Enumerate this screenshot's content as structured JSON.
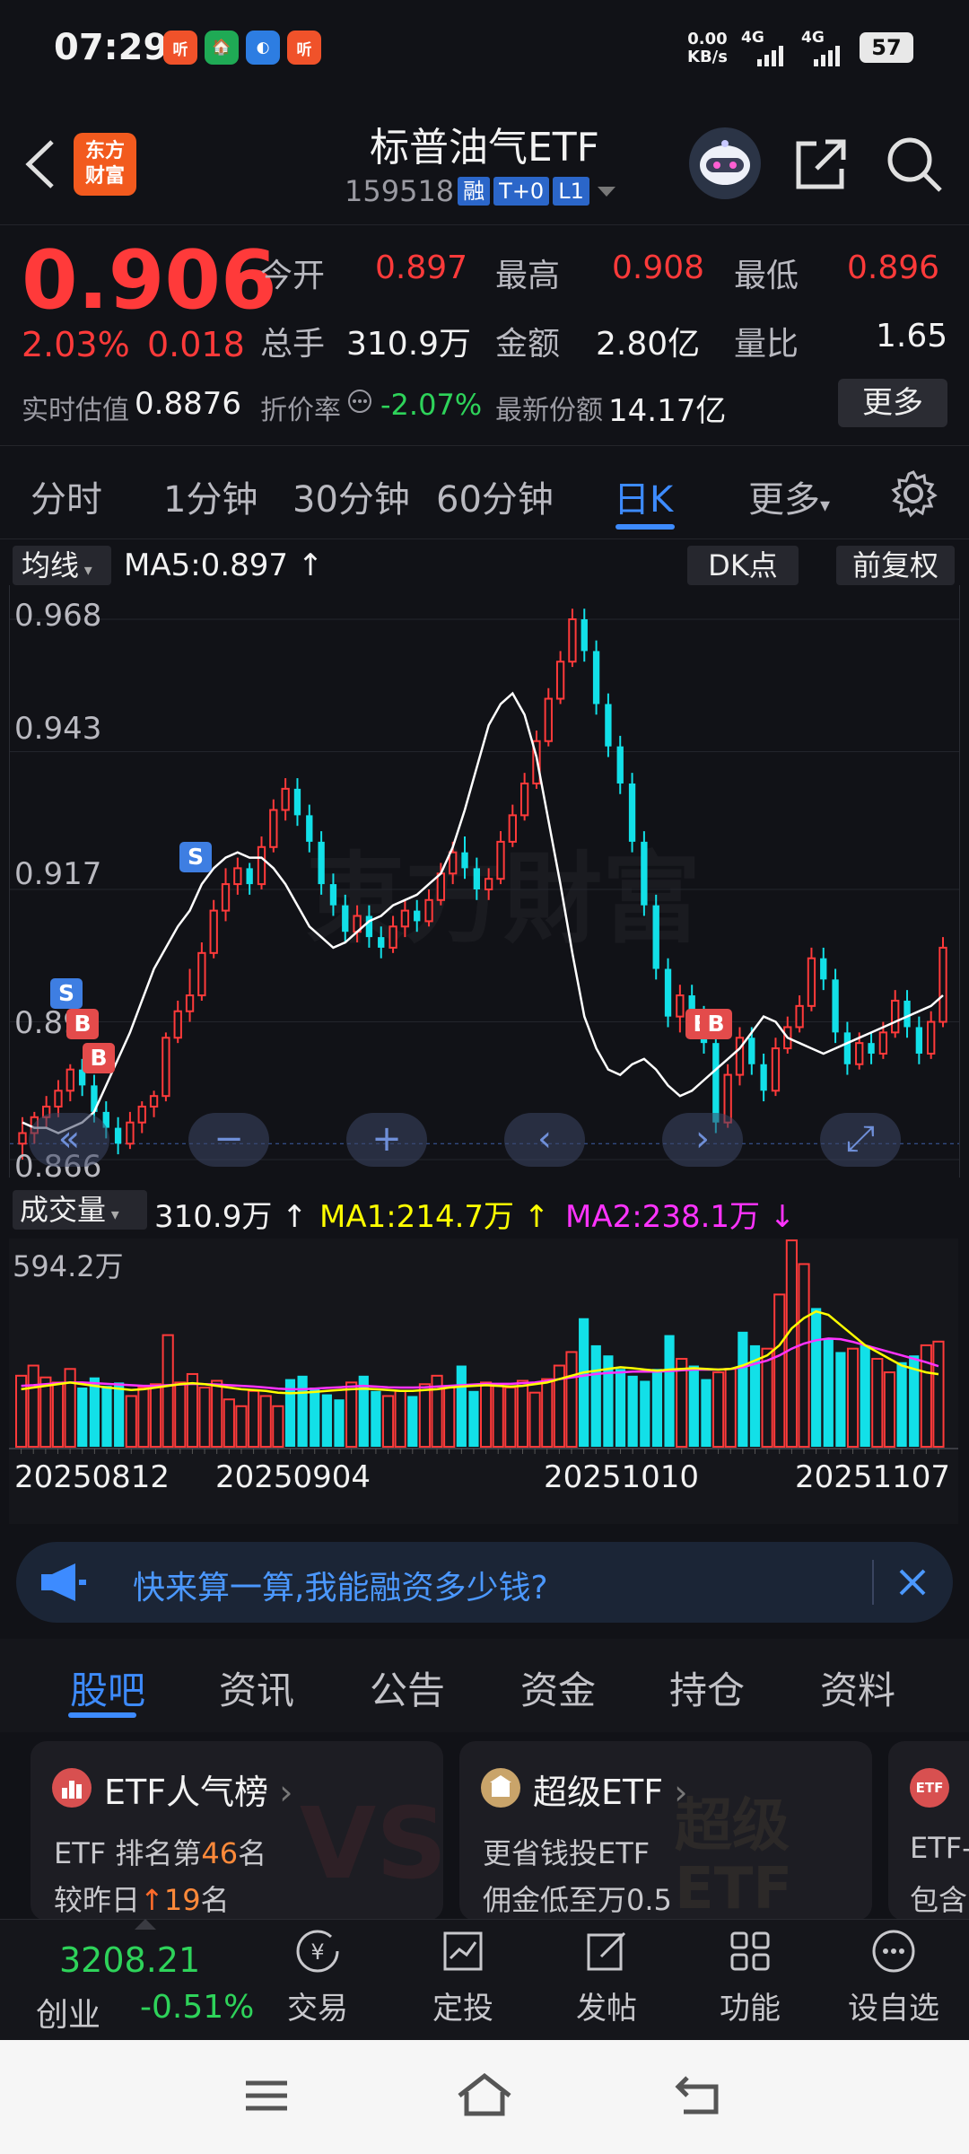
{
  "status_bar": {
    "time": "07:29",
    "apps": [
      "听",
      "🏠",
      "◐",
      "听"
    ],
    "net_speed": "0.00",
    "net_unit": "KB/s",
    "sig1": "4G",
    "sig2": "4G",
    "battery": "57"
  },
  "header": {
    "logo_line1": "东方",
    "logo_line2": "财富",
    "title": "标普油气ETF",
    "code": "159518",
    "tags": [
      "融",
      "T+0",
      "L1"
    ]
  },
  "quote": {
    "price": "0.906",
    "change_pct": "2.03%",
    "change_abs": "0.018",
    "open_label": "今开",
    "open_value": "0.897",
    "high_label": "最高",
    "high_value": "0.908",
    "low_label": "最低",
    "low_value": "0.896",
    "volume_label": "总手",
    "volume_value": "310.9万",
    "amount_label": "金额",
    "amount_value": "2.80亿",
    "ratio_label": "量比",
    "ratio_value": "1.65",
    "iopv_label": "实时估值",
    "iopv_value": "0.8876",
    "discount_label": "折价率",
    "discount_value": "-2.07%",
    "shares_label": "最新份额",
    "shares_value": "14.17亿",
    "more_button": "更多"
  },
  "period_tabs": [
    "分时",
    "1分钟",
    "30分钟",
    "60分钟",
    "日K",
    "更多"
  ],
  "active_period": "日K",
  "chart_toolbar": {
    "indicator": "均线",
    "ma5": "MA5:0.897",
    "dk_button": "DK点",
    "adjust_button": "前复权"
  },
  "price_axis": [
    "0.968",
    "0.943",
    "0.917",
    "0.892",
    "0.866"
  ],
  "signals": [
    "S",
    "B",
    "B",
    "S",
    "B",
    "B"
  ],
  "volume_toolbar": {
    "indicator": "成交量",
    "vol": "310.9万",
    "ma1": "MA1:214.7万",
    "ma2": "MA2:238.1万",
    "max_label": "594.2万"
  },
  "date_axis": [
    "20250812",
    "20250904",
    "20251010",
    "20251107"
  ],
  "colors": {
    "up": "#ff3a3a",
    "down": "#12e0e8",
    "ma5": "#ffffff",
    "ma1": "#ffff00",
    "ma2": "#ff33ff",
    "accent": "#3d8bff"
  },
  "chart_data": {
    "type": "candlestick",
    "price_axis_ticks": [
      0.968,
      0.943,
      0.917,
      0.892,
      0.866
    ],
    "candles": [
      [
        0.869,
        0.871,
        0.866,
        0.874
      ],
      [
        0.871,
        0.874,
        0.869,
        0.875
      ],
      [
        0.874,
        0.876,
        0.872,
        0.878
      ],
      [
        0.876,
        0.879,
        0.874,
        0.881
      ],
      [
        0.879,
        0.883,
        0.877,
        0.884
      ],
      [
        0.883,
        0.88,
        0.878,
        0.885
      ],
      [
        0.88,
        0.875,
        0.873,
        0.882
      ],
      [
        0.875,
        0.872,
        0.87,
        0.877
      ],
      [
        0.872,
        0.869,
        0.867,
        0.874
      ],
      [
        0.869,
        0.873,
        0.868,
        0.875
      ],
      [
        0.873,
        0.876,
        0.871,
        0.877
      ],
      [
        0.876,
        0.878,
        0.874,
        0.879
      ],
      [
        0.878,
        0.889,
        0.877,
        0.89
      ],
      [
        0.889,
        0.894,
        0.888,
        0.896
      ],
      [
        0.894,
        0.897,
        0.892,
        0.902
      ],
      [
        0.897,
        0.905,
        0.896,
        0.907
      ],
      [
        0.905,
        0.913,
        0.904,
        0.915
      ],
      [
        0.913,
        0.918,
        0.911,
        0.921
      ],
      [
        0.918,
        0.921,
        0.916,
        0.923
      ],
      [
        0.921,
        0.918,
        0.916,
        0.922
      ],
      [
        0.918,
        0.925,
        0.917,
        0.927
      ],
      [
        0.925,
        0.932,
        0.924,
        0.934
      ],
      [
        0.932,
        0.936,
        0.93,
        0.938
      ],
      [
        0.936,
        0.931,
        0.929,
        0.938
      ],
      [
        0.931,
        0.926,
        0.924,
        0.933
      ],
      [
        0.926,
        0.918,
        0.916,
        0.928
      ],
      [
        0.918,
        0.914,
        0.912,
        0.92
      ],
      [
        0.914,
        0.909,
        0.907,
        0.916
      ],
      [
        0.909,
        0.912,
        0.907,
        0.914
      ],
      [
        0.912,
        0.908,
        0.906,
        0.914
      ],
      [
        0.908,
        0.906,
        0.904,
        0.91
      ],
      [
        0.906,
        0.91,
        0.905,
        0.912
      ],
      [
        0.91,
        0.913,
        0.908,
        0.915
      ],
      [
        0.913,
        0.911,
        0.909,
        0.915
      ],
      [
        0.911,
        0.915,
        0.91,
        0.917
      ],
      [
        0.915,
        0.92,
        0.914,
        0.922
      ],
      [
        0.92,
        0.924,
        0.918,
        0.926
      ],
      [
        0.924,
        0.921,
        0.919,
        0.927
      ],
      [
        0.921,
        0.917,
        0.915,
        0.923
      ],
      [
        0.917,
        0.919,
        0.915,
        0.921
      ],
      [
        0.919,
        0.926,
        0.918,
        0.928
      ],
      [
        0.926,
        0.931,
        0.925,
        0.933
      ],
      [
        0.931,
        0.937,
        0.93,
        0.939
      ],
      [
        0.937,
        0.945,
        0.936,
        0.947
      ],
      [
        0.945,
        0.953,
        0.944,
        0.955
      ],
      [
        0.953,
        0.96,
        0.952,
        0.962
      ],
      [
        0.96,
        0.968,
        0.959,
        0.97
      ],
      [
        0.968,
        0.962,
        0.96,
        0.97
      ],
      [
        0.962,
        0.952,
        0.95,
        0.964
      ],
      [
        0.952,
        0.944,
        0.942,
        0.954
      ],
      [
        0.944,
        0.937,
        0.935,
        0.946
      ],
      [
        0.937,
        0.926,
        0.924,
        0.939
      ],
      [
        0.926,
        0.914,
        0.912,
        0.928
      ],
      [
        0.914,
        0.902,
        0.9,
        0.916
      ],
      [
        0.902,
        0.893,
        0.891,
        0.904
      ],
      [
        0.893,
        0.897,
        0.89,
        0.899
      ],
      [
        0.897,
        0.893,
        0.891,
        0.899
      ],
      [
        0.893,
        0.888,
        0.886,
        0.895
      ],
      [
        0.888,
        0.873,
        0.871,
        0.89
      ],
      [
        0.873,
        0.882,
        0.872,
        0.884
      ],
      [
        0.882,
        0.889,
        0.88,
        0.891
      ],
      [
        0.889,
        0.884,
        0.882,
        0.891
      ],
      [
        0.884,
        0.879,
        0.877,
        0.886
      ],
      [
        0.879,
        0.887,
        0.878,
        0.889
      ],
      [
        0.887,
        0.891,
        0.886,
        0.893
      ],
      [
        0.891,
        0.895,
        0.89,
        0.897
      ],
      [
        0.895,
        0.904,
        0.894,
        0.906
      ],
      [
        0.904,
        0.9,
        0.898,
        0.906
      ],
      [
        0.9,
        0.89,
        0.888,
        0.902
      ],
      [
        0.89,
        0.884,
        0.882,
        0.892
      ],
      [
        0.884,
        0.888,
        0.883,
        0.89
      ],
      [
        0.888,
        0.886,
        0.884,
        0.89
      ],
      [
        0.886,
        0.89,
        0.885,
        0.892
      ],
      [
        0.89,
        0.896,
        0.889,
        0.898
      ],
      [
        0.896,
        0.891,
        0.889,
        0.898
      ],
      [
        0.891,
        0.886,
        0.884,
        0.893
      ],
      [
        0.886,
        0.892,
        0.885,
        0.894
      ],
      [
        0.892,
        0.906,
        0.891,
        0.908
      ]
    ],
    "ma5": [
      0.873,
      0.872,
      0.872,
      0.871,
      0.872,
      0.873,
      0.875,
      0.88,
      0.885,
      0.89,
      0.896,
      0.902,
      0.906,
      0.91,
      0.913,
      0.918,
      0.921,
      0.923,
      0.924,
      0.923,
      0.923,
      0.921,
      0.918,
      0.914,
      0.91,
      0.908,
      0.906,
      0.907,
      0.909,
      0.911,
      0.912,
      0.914,
      0.915,
      0.916,
      0.918,
      0.92,
      0.925,
      0.932,
      0.94,
      0.948,
      0.952,
      0.954,
      0.95,
      0.942,
      0.93,
      0.918,
      0.905,
      0.893,
      0.887,
      0.883,
      0.882,
      0.884,
      0.885,
      0.883,
      0.88,
      0.878,
      0.879,
      0.881,
      0.883,
      0.885,
      0.887,
      0.89,
      0.893,
      0.892,
      0.889,
      0.888,
      0.887,
      0.886,
      0.887,
      0.888,
      0.889,
      0.89,
      0.891,
      0.892,
      0.893,
      0.894,
      0.895,
      0.897
    ],
    "volume_max": 594.2,
    "volumes": [
      210,
      240,
      205,
      190,
      230,
      175,
      205,
      180,
      190,
      150,
      175,
      185,
      330,
      190,
      215,
      175,
      195,
      140,
      120,
      165,
      150,
      120,
      200,
      210,
      175,
      155,
      140,
      190,
      210,
      165,
      150,
      165,
      150,
      185,
      210,
      175,
      240,
      165,
      190,
      180,
      175,
      195,
      160,
      200,
      240,
      280,
      380,
      300,
      270,
      230,
      210,
      195,
      230,
      330,
      260,
      240,
      200,
      220,
      230,
      340,
      300,
      290,
      450,
      610,
      540,
      410,
      320,
      280,
      290,
      300,
      260,
      220,
      250,
      270,
      300,
      310.9
    ],
    "ma1": [
      170,
      175,
      180,
      185,
      190,
      185,
      180,
      175,
      172,
      168,
      170,
      175,
      180,
      185,
      188,
      185,
      180,
      175,
      170,
      168,
      165,
      160,
      158,
      160,
      162,
      165,
      168,
      170,
      172,
      170,
      168,
      165,
      165,
      168,
      170,
      175,
      178,
      180,
      182,
      180,
      178,
      180,
      185,
      190,
      200,
      210,
      220,
      225,
      230,
      235,
      232,
      228,
      225,
      228,
      230,
      232,
      230,
      228,
      230,
      240,
      255,
      270,
      300,
      350,
      380,
      400,
      390,
      360,
      330,
      300,
      280,
      260,
      240,
      230,
      220,
      214.7
    ],
    "ma2": [
      180,
      182,
      185,
      188,
      190,
      190,
      188,
      186,
      184,
      182,
      180,
      180,
      182,
      184,
      186,
      185,
      184,
      182,
      180,
      178,
      175,
      172,
      170,
      170,
      172,
      174,
      176,
      178,
      180,
      178,
      176,
      175,
      175,
      176,
      178,
      180,
      182,
      184,
      186,
      186,
      186,
      188,
      190,
      195,
      200,
      205,
      210,
      215,
      218,
      220,
      222,
      222,
      222,
      224,
      226,
      228,
      228,
      228,
      230,
      235,
      245,
      255,
      270,
      290,
      305,
      315,
      320,
      318,
      310,
      300,
      290,
      280,
      270,
      260,
      250,
      238.1
    ]
  },
  "banner": {
    "text": "快来算一算,我能融资多少钱?"
  },
  "content_tabs": [
    "股吧",
    "资讯",
    "公告",
    "资金",
    "持仓",
    "资料"
  ],
  "active_content_tab": "股吧",
  "cards": [
    {
      "title": "ETF人气榜",
      "line1_prefix": "ETF 排名第",
      "line1_value": "46",
      "line1_suffix": "名",
      "line2_prefix": "较昨日",
      "line2_value": "19",
      "line2_suffix": "名"
    },
    {
      "title": "超级ETF",
      "line1": "更省钱投ETF",
      "line2": "佣金低至万0.5",
      "watermark": "超级ETF"
    },
    {
      "title": "ETF",
      "line1": "ETF-",
      "line2": "包含"
    }
  ],
  "bottom_nav": {
    "index_value": "3208.21",
    "index_name": "创业",
    "index_change": "-0.51%",
    "items": [
      "交易",
      "定投",
      "发帖",
      "功能",
      "设自选"
    ]
  }
}
